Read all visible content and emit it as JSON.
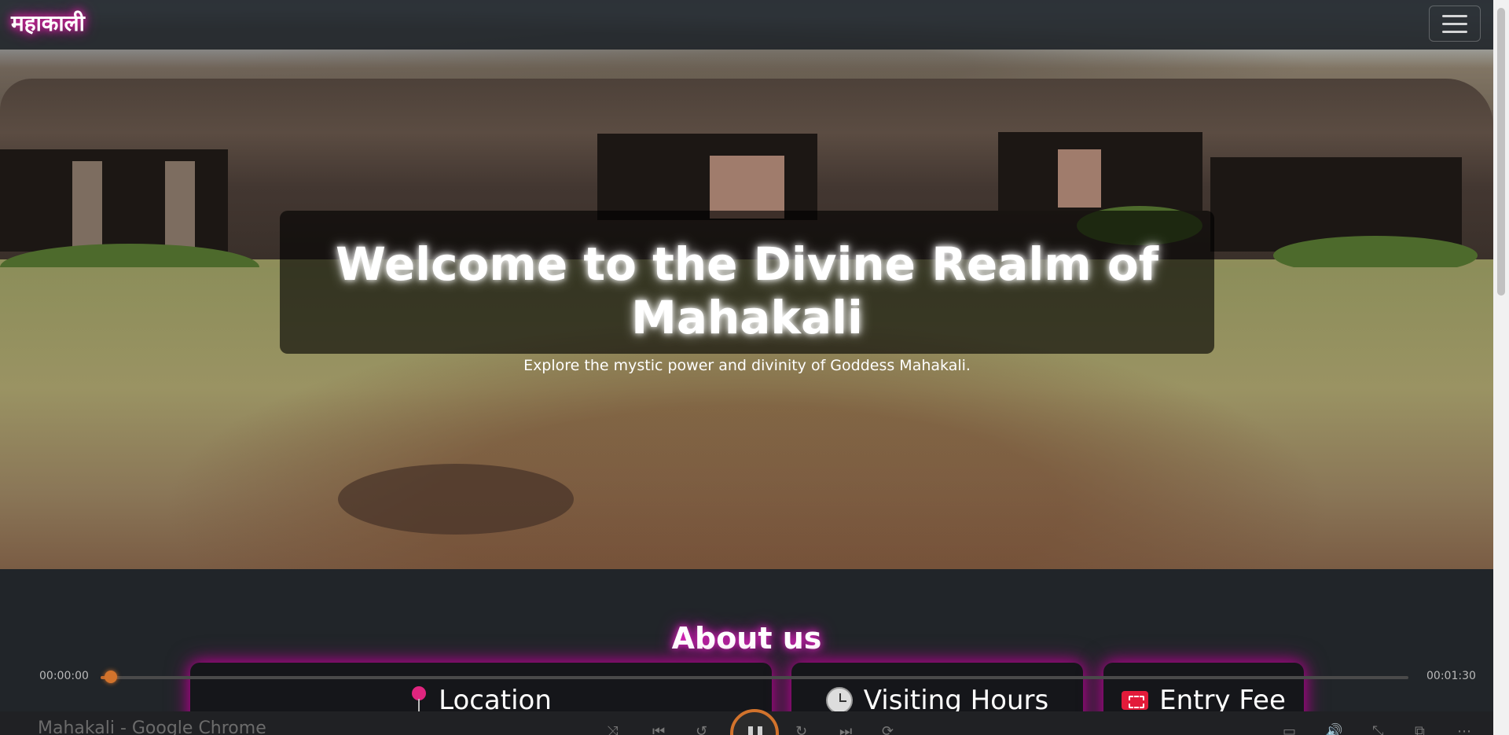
{
  "navbar": {
    "brand": "महाकाली",
    "menu_icon": "hamburger-icon"
  },
  "hero": {
    "title": "Welcome to the Divine Realm of Mahakali",
    "subtitle": "Explore the mystic power and divinity of Goddess Mahakali."
  },
  "about": {
    "title": "About us",
    "cards": [
      {
        "label": "Location",
        "icon": "pushpin-icon"
      },
      {
        "label": "Visiting Hours",
        "icon": "clock-icon"
      },
      {
        "label": "Entry Fee",
        "icon": "ticket-icon"
      }
    ]
  },
  "player": {
    "current_time": "00:00:00",
    "total_time": "00:01:30",
    "progress_fraction": 0.008,
    "state_icon": "pause-icon"
  },
  "window": {
    "title": "Mahakali - Google Chrome"
  },
  "colors": {
    "accent_glow": "#b3008f",
    "player_accent": "#d2732c",
    "background": "#212529"
  }
}
